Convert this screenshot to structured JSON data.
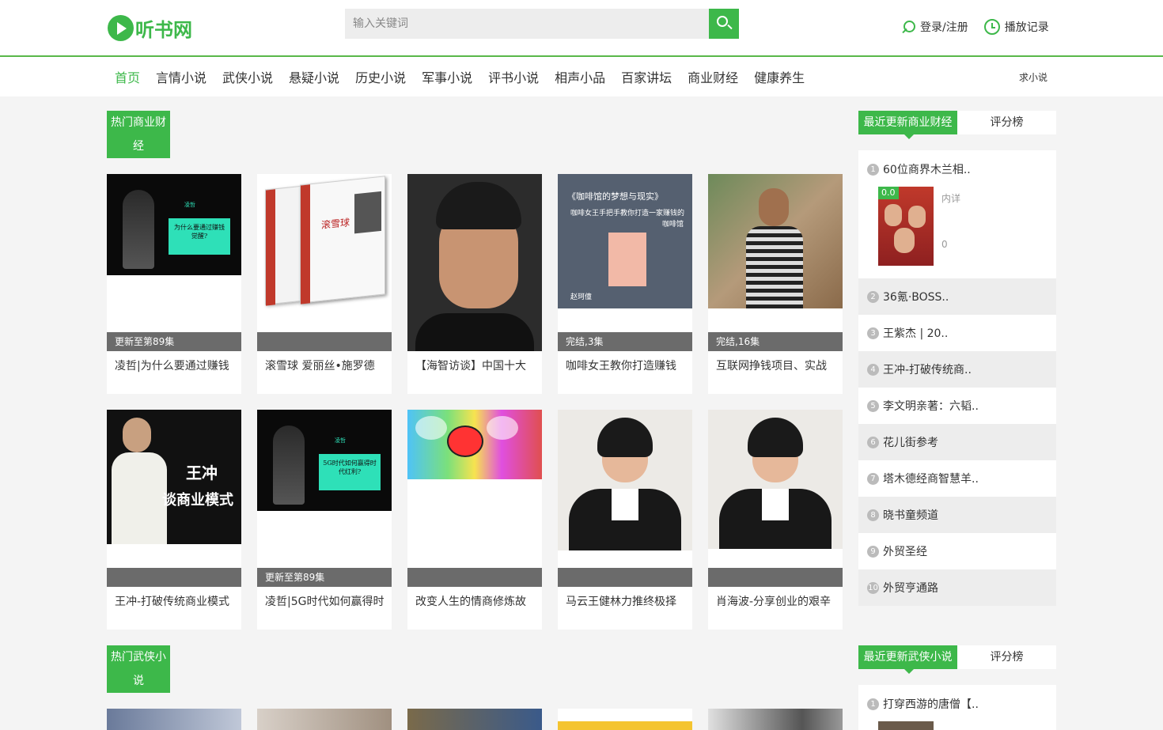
{
  "header": {
    "logo_text": "听书网",
    "search_placeholder": "输入关键词",
    "login_label": "登录/注册",
    "history_label": "播放记录"
  },
  "nav": {
    "items": [
      "首页",
      "言情小说",
      "武侠小说",
      "悬疑小说",
      "历史小说",
      "军事小说",
      "评书小说",
      "相声小品",
      "百家讲坛",
      "商业财经",
      "健康养生"
    ],
    "right_link": "求小说"
  },
  "section1": {
    "title": "热门商业财经",
    "cards": [
      {
        "status": "更新至第89集",
        "title": "凌哲|为什么要通过赚钱"
      },
      {
        "status": "",
        "title": "滚雪球 爱丽丝•施罗德"
      },
      {
        "status": "",
        "title": "【海智访谈】中国十大"
      },
      {
        "status": "完结,3集",
        "title": "咖啡女王教你打造赚钱"
      },
      {
        "status": "完结,16集",
        "title": "互联网挣钱项目、实战"
      },
      {
        "status": "",
        "title": "王冲-打破传统商业模式"
      },
      {
        "status": "更新至第89集",
        "title": "凌哲|5G时代如何赢得时"
      },
      {
        "status": "",
        "title": "改变人生的情商修炼故"
      },
      {
        "status": "",
        "title": "马云王健林力推终极择"
      },
      {
        "status": "",
        "title": "肖海波-分享创业的艰辛"
      }
    ],
    "cover_texts": {
      "c1": "为什么要通过赚钱觉醒?",
      "c1_small": "凌哲",
      "c2": "滚雪球",
      "c4_line1": "《咖啡馆的梦想与现实》",
      "c4_line2": "咖啡女王手把手教你打造一家赚钱的",
      "c4_line3": "咖啡馆",
      "c4_author": "赵珂僮",
      "c6_line1": "王冲",
      "c6_line2": "谈商业模式",
      "c7": "5G时代如何赢得时代红利?",
      "c7_small": "凌哲"
    }
  },
  "sidebar1": {
    "tab_active": "最近更新商业财经",
    "tab_other": "评分榜",
    "top_item": {
      "num": "1",
      "title": "60位商界木兰相..",
      "score": "0.0",
      "meta1": "内详",
      "meta2": "0"
    },
    "items": [
      {
        "num": "2",
        "title": "36氪·BOSS.."
      },
      {
        "num": "3",
        "title": "王紫杰 | 20.."
      },
      {
        "num": "4",
        "title": "王冲-打破传统商.."
      },
      {
        "num": "5",
        "title": "李文明亲著：六韬.."
      },
      {
        "num": "6",
        "title": "花儿街参考"
      },
      {
        "num": "7",
        "title": "塔木德经商智慧羊.."
      },
      {
        "num": "8",
        "title": "晓书童频道"
      },
      {
        "num": "9",
        "title": "外贸圣经"
      },
      {
        "num": "10",
        "title": "外贸亨通路"
      }
    ]
  },
  "section2": {
    "title": "热门武侠小说"
  },
  "sidebar2": {
    "tab_active": "最近更新武侠小说",
    "tab_other": "评分榜",
    "top_item": {
      "num": "1",
      "title": "打穿西游的唐僧【.."
    }
  },
  "colors": {
    "brand_green": "#3db84a",
    "status_bar": "#6b6b6b"
  }
}
